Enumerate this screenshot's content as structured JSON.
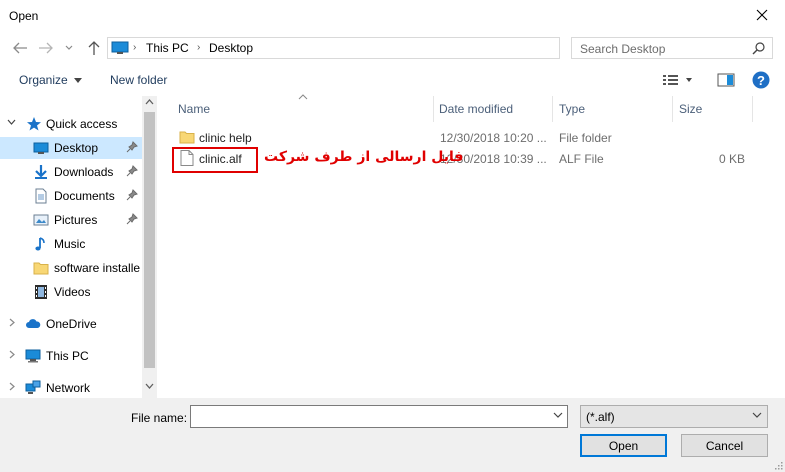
{
  "window": {
    "title": "Open"
  },
  "address": {
    "crumbs": [
      "This PC",
      "Desktop"
    ]
  },
  "search": {
    "placeholder": "Search Desktop"
  },
  "toolbar": {
    "organize": "Organize",
    "new_folder": "New folder",
    "help": "?"
  },
  "nav": {
    "items": [
      {
        "label": "Quick access",
        "icon": "star-icon"
      },
      {
        "label": "Desktop",
        "icon": "desktop-icon",
        "selected": true,
        "pinned": true
      },
      {
        "label": "Downloads",
        "icon": "download-icon",
        "pinned": true
      },
      {
        "label": "Documents",
        "icon": "documents-icon",
        "pinned": true
      },
      {
        "label": "Pictures",
        "icon": "pictures-icon",
        "pinned": true
      },
      {
        "label": "Music",
        "icon": "music-icon"
      },
      {
        "label": "software installe",
        "icon": "folder-icon"
      },
      {
        "label": "Videos",
        "icon": "videos-icon"
      },
      {
        "label": "OneDrive",
        "icon": "cloud-icon"
      },
      {
        "label": "This PC",
        "icon": "computer-icon"
      },
      {
        "label": "Network",
        "icon": "network-icon"
      }
    ]
  },
  "columns": {
    "name": "Name",
    "date": "Date modified",
    "type": "Type",
    "size": "Size"
  },
  "files": [
    {
      "name": "clinic help",
      "date": "12/30/2018 10:20 ...",
      "type": "File folder",
      "size": ""
    },
    {
      "name": "clinic.alf",
      "date": "12/30/2018 10:39 ...",
      "type": "ALF File",
      "size": "0 KB"
    }
  ],
  "annotation": {
    "text": "فایل ارسالی از طرف شرکت",
    "color": "#e00000"
  },
  "bottom": {
    "file_name_label": "File name:",
    "file_name_value": "",
    "filter": "(*.alf)",
    "open": "Open",
    "cancel": "Cancel"
  },
  "colors": {
    "accent": "#0078d7",
    "selected": "#cce8ff",
    "folder": "#f8d775"
  }
}
